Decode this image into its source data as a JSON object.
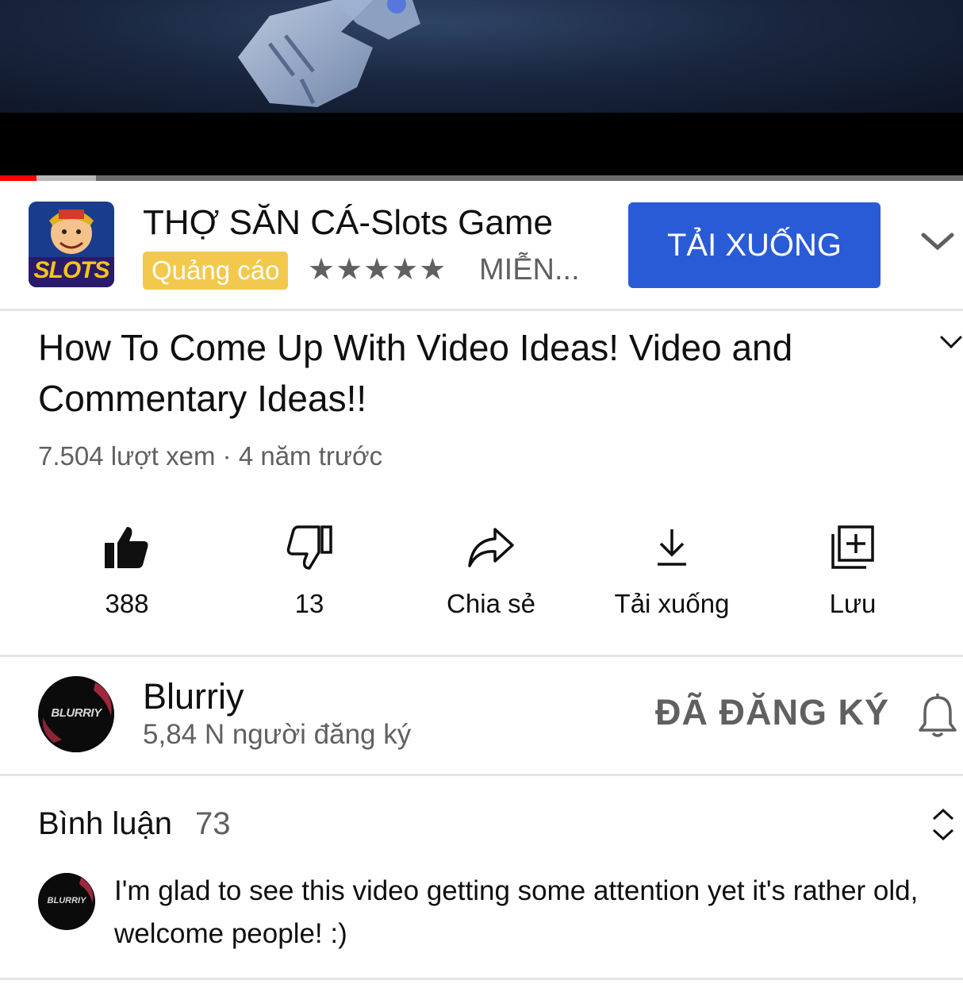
{
  "player": {
    "progress_played": 0.038,
    "progress_buffered": 0.1
  },
  "ad": {
    "icon_text": "SLOTS",
    "title": "THỢ SĂN CÁ-Slots Game",
    "badge": "Quảng cáo",
    "rating_stars": "★★★★★",
    "price": "MIỄN...",
    "cta_label": "TẢI XUỐNG",
    "cta_color": "#2a5bd7",
    "badge_color": "#f2c94c"
  },
  "video": {
    "title": "How To Come Up With Video Ideas! Video and Commentary Ideas!!",
    "meta": "7.504 lượt xem · 4 năm trước"
  },
  "actions": {
    "like_count": "388",
    "dislike_count": "13",
    "share_label": "Chia sẻ",
    "download_label": "Tải xuống",
    "save_label": "Lưu"
  },
  "channel": {
    "name": "Blurriy",
    "subscribers": "5,84 N người đăng ký",
    "subscribed_label": "ĐÃ ĐĂNG KÝ",
    "avatar_text": "BLURRIY"
  },
  "comments": {
    "title": "Bình luận",
    "count": "73",
    "top_comment": "I'm glad to see this video getting some attention yet it's rather old, welcome people! :)"
  },
  "icons": [
    "chevron-down-icon",
    "thumbs-up-icon",
    "thumbs-down-icon",
    "share-icon",
    "download-icon",
    "save-playlist-icon",
    "bell-icon",
    "sort-icon"
  ]
}
